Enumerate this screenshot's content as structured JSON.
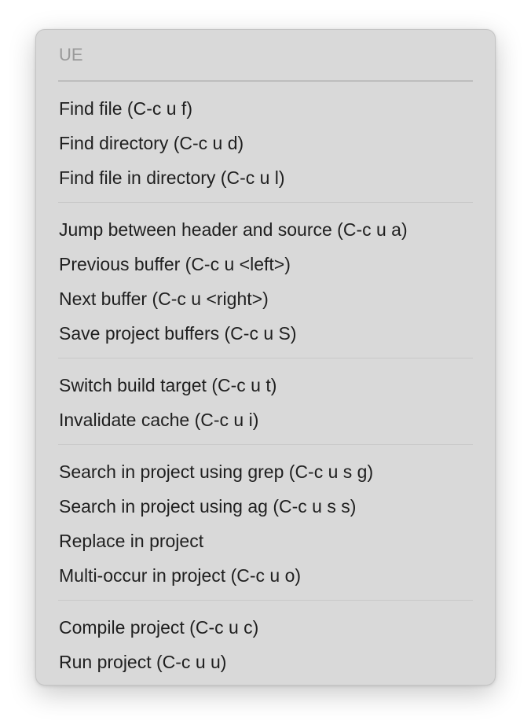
{
  "menu": {
    "title": "UE",
    "groups": [
      {
        "items": [
          "Find file (C-c u f)",
          "Find directory (C-c u d)",
          "Find file in directory (C-c u l)"
        ]
      },
      {
        "items": [
          "Jump between header and source (C-c u a)",
          "Previous buffer (C-c u <left>)",
          "Next buffer (C-c u <right>)",
          "Save project buffers (C-c u S)"
        ]
      },
      {
        "items": [
          "Switch build target (C-c u t)",
          "Invalidate cache (C-c u i)"
        ]
      },
      {
        "items": [
          "Search in project using grep (C-c u s g)",
          "Search in project using ag (C-c u s s)",
          "Replace in project",
          "Multi-occur in project (C-c u o)"
        ]
      },
      {
        "items": [
          "Compile project (C-c u c)",
          "Run project (C-c u u)"
        ]
      }
    ]
  }
}
